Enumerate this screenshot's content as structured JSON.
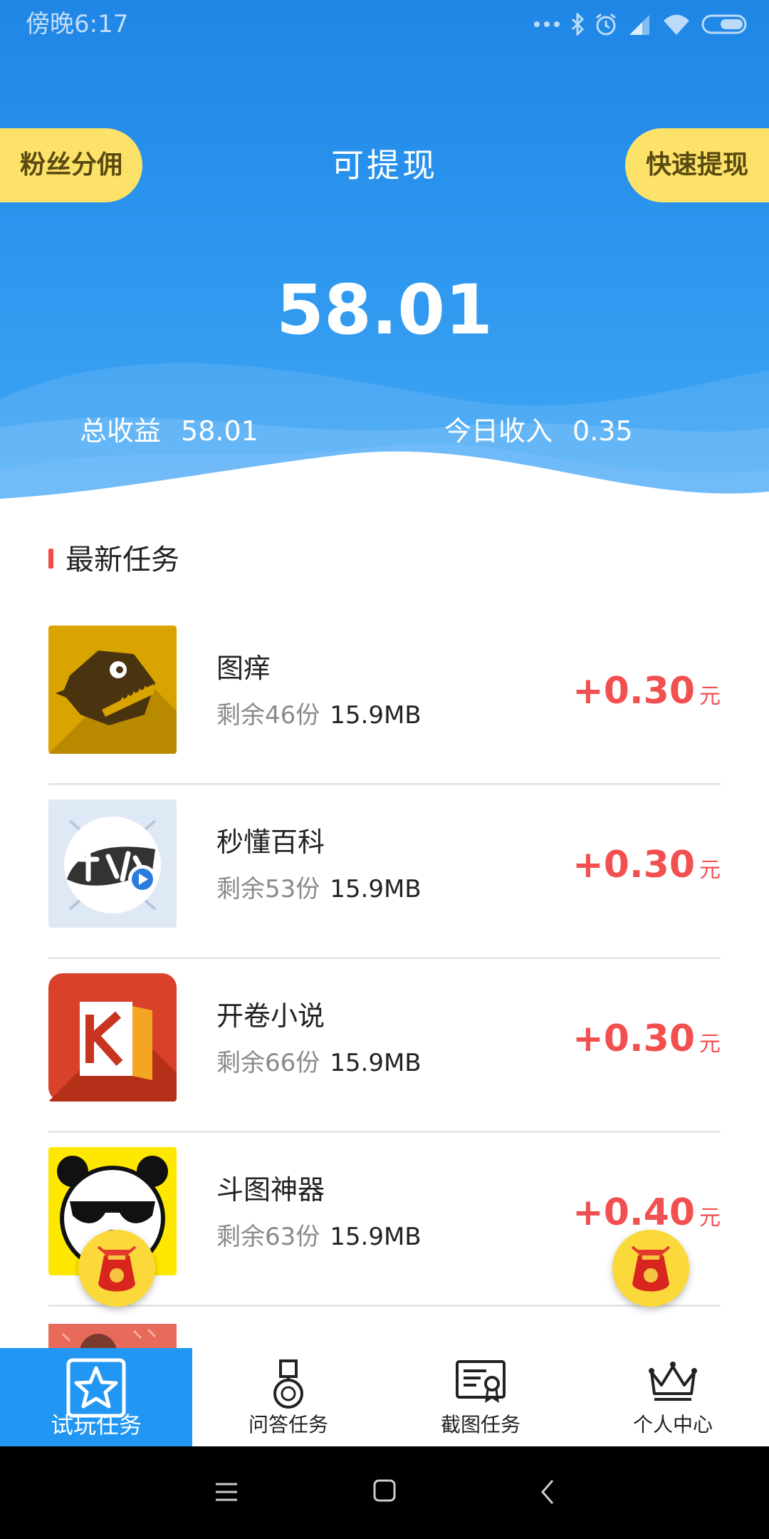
{
  "status_bar": {
    "time": "傍晚6:17"
  },
  "header": {
    "left_button": "粉丝分佣",
    "title": "可提现",
    "right_button": "快速提现",
    "balance": "58.01",
    "total_label": "总收益",
    "total_value": "58.01",
    "today_label": "今日收入",
    "today_value": "0.35"
  },
  "section": {
    "title": "最新任务"
  },
  "tasks": [
    {
      "name": "图痒",
      "remain": "剩余46份",
      "size": "15.9MB",
      "reward": "+0.30",
      "unit": "元",
      "icon": "dinosaur-app-icon"
    },
    {
      "name": "秒懂百科",
      "remain": "剩余53份",
      "size": "15.9MB",
      "reward": "+0.30",
      "unit": "元",
      "icon": "miao-app-icon"
    },
    {
      "name": "开卷小说",
      "remain": "剩余66份",
      "size": "15.9MB",
      "reward": "+0.30",
      "unit": "元",
      "icon": "book-k-app-icon"
    },
    {
      "name": "斗图神器",
      "remain": "剩余63份",
      "size": "15.9MB",
      "reward": "+0.40",
      "unit": "元",
      "icon": "panda-app-icon"
    }
  ],
  "tabs": [
    {
      "label": "试玩任务",
      "icon": "star-icon",
      "active": true
    },
    {
      "label": "问答任务",
      "icon": "medal-icon",
      "active": false
    },
    {
      "label": "截图任务",
      "icon": "certificate-icon",
      "active": false
    },
    {
      "label": "个人中心",
      "icon": "crown-icon",
      "active": false
    }
  ],
  "colors": {
    "header_blue": "#2b95ee",
    "pill_yellow": "#fde26a",
    "reward_red": "#f25050",
    "active_tab": "#2196f3"
  }
}
